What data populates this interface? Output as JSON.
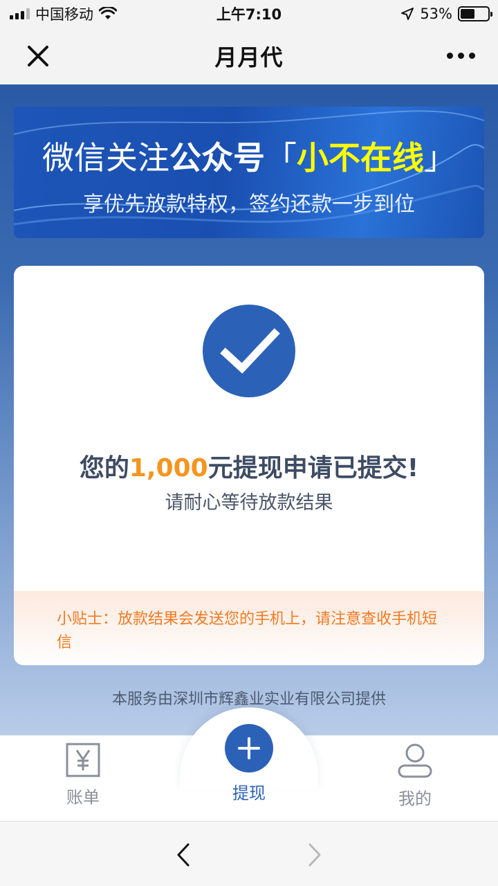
{
  "status_bar": {
    "carrier": "中国移动",
    "time": "上午7:10",
    "battery_percent_text": "53%",
    "battery_level": 0.53
  },
  "navbar": {
    "title": "月月代"
  },
  "banner": {
    "line1_prefix": "微信关注",
    "line1_bold": "公众号",
    "line1_quote_open": "「",
    "line1_highlight": "小不在线",
    "line1_quote_close": "」",
    "line2": "享优先放款特权，签约还款一步到位"
  },
  "result": {
    "title_prefix": "您的",
    "amount": "1,000",
    "title_suffix": "元提现申请已提交!",
    "subtitle": "请耐心等待放款结果"
  },
  "tip": {
    "text": "小贴士：放款结果会发送您的手机上，请注意查收手机短信"
  },
  "footer_note": "本服务由深圳市辉鑫业实业有限公司提供",
  "tabs": [
    {
      "label": "账单",
      "icon": "bill-icon",
      "active": false
    },
    {
      "label": "提现",
      "icon": "plus-icon",
      "active": true
    },
    {
      "label": "我的",
      "icon": "user-icon",
      "active": false
    }
  ],
  "colors": {
    "brand_blue": "#2b62b8",
    "amount_orange": "#f5951f",
    "tip_orange": "#f07a22",
    "banner_highlight": "#ffff00"
  }
}
